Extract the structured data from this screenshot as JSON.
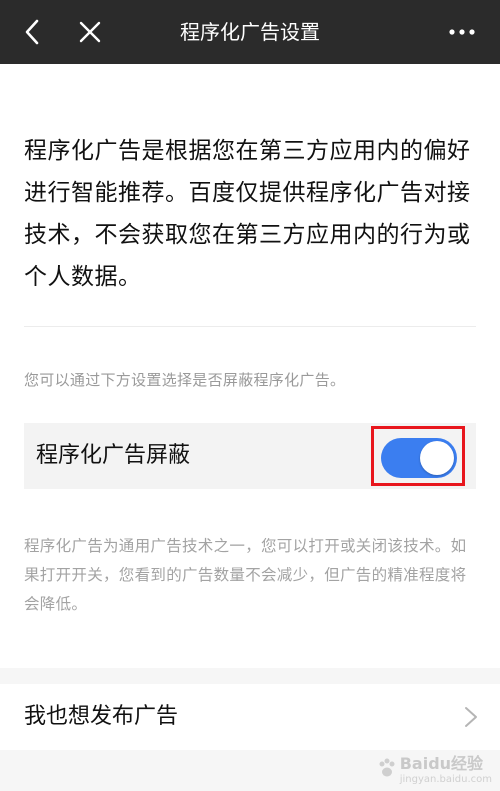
{
  "header": {
    "title": "程序化广告设置",
    "icons": {
      "back": "back-icon",
      "close": "close-icon",
      "more": "more-icon"
    }
  },
  "intro": {
    "text": "程序化广告是根据您在第三方应用内的偏好进行智能推荐。百度仅提供程序化广告对接技术，不会获取您在第三方应用内的行为或个人数据。"
  },
  "setting": {
    "hint": "您可以通过下方设置选择是否屏蔽程序化广告。",
    "label": "程序化广告屏蔽",
    "toggle_on": true,
    "description": "程序化广告为通用广告技术之一，您可以打开或关闭该技术。如果打开开关，您看到的广告数量不会减少，但广告的精准程度将会降低。"
  },
  "publish": {
    "label": "我也想发布广告"
  },
  "watermark": {
    "brand": "Baidu经验",
    "sub": "jingyan.baidu.com"
  },
  "colors": {
    "nav_bg": "#2b2b2b",
    "toggle_on": "#3b7ef0",
    "highlight": "#e8161d"
  }
}
